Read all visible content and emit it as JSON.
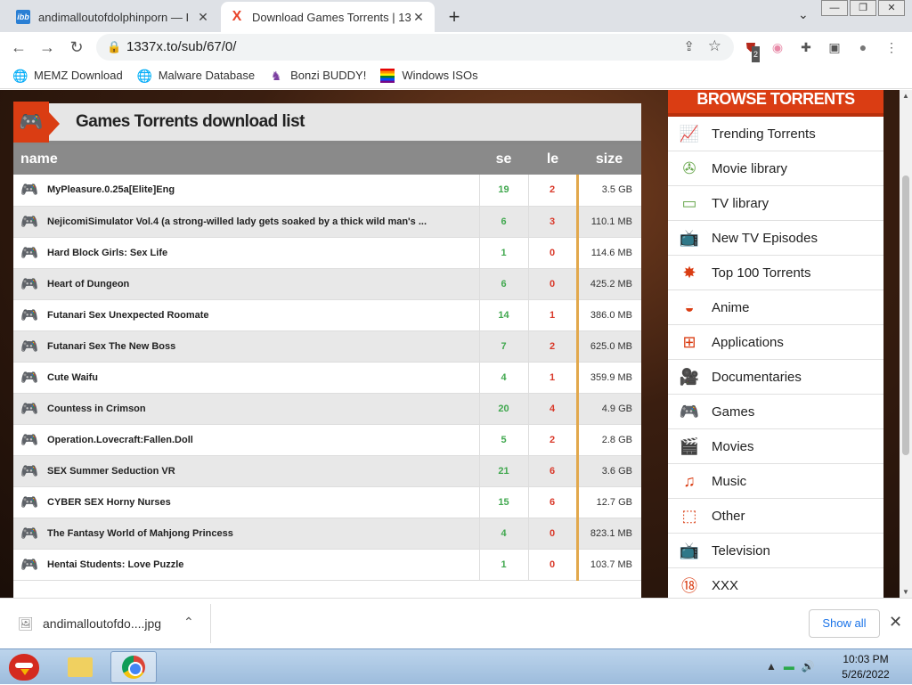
{
  "browser": {
    "tabs": [
      {
        "title": "andimalloutofdolphinporn — I",
        "favicon": "ibb",
        "active": false
      },
      {
        "title": "Download Games Torrents | 13",
        "favicon": "X",
        "active": true
      }
    ],
    "new_tab": "+",
    "url": "1337x.to/sub/67/0/",
    "bookmarks": [
      {
        "label": "MEMZ Download",
        "icon": "globe-icon"
      },
      {
        "label": "Malware Database",
        "icon": "globe-icon"
      },
      {
        "label": "Bonzi BUDDY!",
        "icon": "bonzi-icon"
      },
      {
        "label": "Windows ISOs",
        "icon": "windows-flag-icon"
      }
    ],
    "extension_badge": "2"
  },
  "panel": {
    "title": "Games Torrents download list",
    "columns": {
      "name": "name",
      "se": "se",
      "le": "le",
      "size": "size"
    },
    "rows": [
      {
        "name": "MyPleasure.0.25a[Elite]Eng",
        "se": "19",
        "le": "2",
        "size": "3.5 GB"
      },
      {
        "name": "NejicomiSimulator Vol.4 (a strong-willed lady gets soaked by a thick wild man's ...",
        "se": "6",
        "le": "3",
        "size": "110.1 MB"
      },
      {
        "name": "Hard Block Girls: Sex Life",
        "se": "1",
        "le": "0",
        "size": "114.6 MB"
      },
      {
        "name": "Heart of Dungeon",
        "se": "6",
        "le": "0",
        "size": "425.2 MB"
      },
      {
        "name": "Futanari Sex Unexpected Roomate",
        "se": "14",
        "le": "1",
        "size": "386.0 MB"
      },
      {
        "name": "Futanari Sex The New Boss",
        "se": "7",
        "le": "2",
        "size": "625.0 MB"
      },
      {
        "name": "Cute Waifu",
        "se": "4",
        "le": "1",
        "size": "359.9 MB"
      },
      {
        "name": "Countess in Crimson",
        "se": "20",
        "le": "4",
        "size": "4.9 GB"
      },
      {
        "name": "Operation.Lovecraft:Fallen.Doll",
        "se": "5",
        "le": "2",
        "size": "2.8 GB"
      },
      {
        "name": "SEX Summer Seduction VR",
        "se": "21",
        "le": "6",
        "size": "3.6 GB"
      },
      {
        "name": "CYBER SEX Horny Nurses",
        "se": "15",
        "le": "6",
        "size": "12.7 GB"
      },
      {
        "name": "The Fantasy World of Mahjong Princess",
        "se": "4",
        "le": "0",
        "size": "823.1 MB"
      },
      {
        "name": "Hentai Students: Love Puzzle",
        "se": "1",
        "le": "0",
        "size": "103.7 MB"
      }
    ]
  },
  "sidebar": {
    "title": "BROWSE TORRENTS",
    "items": [
      {
        "label": "Trending Torrents",
        "icon": "trending-icon"
      },
      {
        "label": "Movie library",
        "icon": "film-reel-icon"
      },
      {
        "label": "TV library",
        "icon": "tv-library-icon"
      },
      {
        "label": "New TV Episodes",
        "icon": "tv-icon"
      },
      {
        "label": "Top 100 Torrents",
        "icon": "top-badge-icon"
      },
      {
        "label": "Anime",
        "icon": "anime-icon"
      },
      {
        "label": "Applications",
        "icon": "windows-icon"
      },
      {
        "label": "Documentaries",
        "icon": "camera-icon"
      },
      {
        "label": "Games",
        "icon": "gamepad-icon"
      },
      {
        "label": "Movies",
        "icon": "clapper-icon"
      },
      {
        "label": "Music",
        "icon": "music-note-icon"
      },
      {
        "label": "Other",
        "icon": "box-icon"
      },
      {
        "label": "Television",
        "icon": "tv-icon"
      },
      {
        "label": "XXX",
        "icon": "eighteen-plus-icon"
      }
    ]
  },
  "downloads": {
    "file": "andimalloutofdo....jpg",
    "show_all": "Show all"
  },
  "taskbar": {
    "time": "10:03 PM",
    "date": "5/26/2022"
  },
  "colors": {
    "accent": "#da3d13",
    "seed_green": "#41a84f",
    "leech_red": "#d9392a"
  }
}
